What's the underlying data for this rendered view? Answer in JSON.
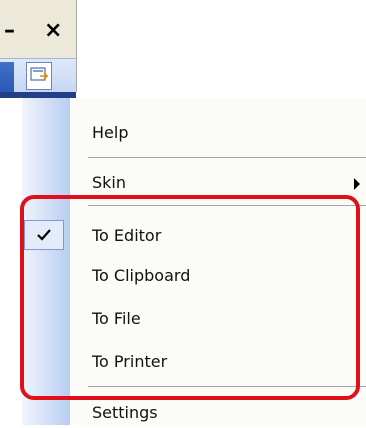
{
  "window": {
    "minimize_glyph": "–",
    "close_glyph": "×"
  },
  "toolbar": {
    "capture_icon": "capture-icon"
  },
  "menu": {
    "items": [
      {
        "label": "Help"
      },
      {
        "label": "Skin",
        "has_submenu": true
      },
      {
        "label": "To Editor",
        "checked": true
      },
      {
        "label": "To Clipboard"
      },
      {
        "label": "To File"
      },
      {
        "label": "To Printer"
      },
      {
        "label": "Settings"
      }
    ]
  },
  "colors": {
    "highlight": "#e0101a",
    "menu_gutter": "#cfddf6"
  }
}
